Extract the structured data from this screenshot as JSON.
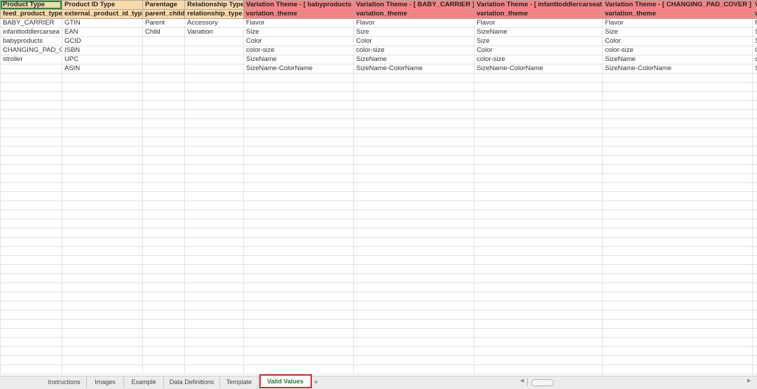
{
  "header_row1": [
    "Product Type",
    "Product ID Type",
    "Parentage",
    "Relationship Type",
    "Variation Theme - [ babyproducts ]",
    "Variation Theme - [ BABY_CARRIER ]",
    "Variation Theme - [ infanttoddlercarseat ]",
    "Variation Theme - [ CHANGING_PAD_COVER ]",
    "V"
  ],
  "header_row2": [
    "feed_product_type",
    "external_product_id_type",
    "parent_child",
    "relationship_type",
    "variation_theme",
    "variation_theme",
    "variation_theme",
    "variation_theme",
    "v"
  ],
  "rows": [
    [
      "BABY_CARRIER",
      "GTIN",
      "Parent",
      "Accessory",
      "Flavor",
      "Flavor",
      "Flavor",
      "Flavor",
      "F"
    ],
    [
      "infanttoddlercarsea",
      "EAN",
      "Child",
      "Variation",
      "Size",
      "Size",
      "SizeName",
      "Size",
      "S"
    ],
    [
      "babyproducts",
      "GCID",
      "",
      "",
      "Color",
      "Color",
      "Size",
      "Color",
      "S"
    ],
    [
      "CHANGING_PAD_C",
      "ISBN",
      "",
      "",
      "color-size",
      "color-size",
      "Color",
      "color-size",
      "C"
    ],
    [
      "stroller",
      "UPC",
      "",
      "",
      "SizeName",
      "SizeName",
      "color-size",
      "SizeName",
      "c"
    ],
    [
      "",
      "ASIN",
      "",
      "",
      "SizeName-ColorName",
      "SizeName-ColorName",
      "SizeName-ColorName",
      "SizeName-ColorName",
      "S"
    ]
  ],
  "sheet_tabs": [
    "Instructions",
    "Images",
    "Example",
    "Data Definitions",
    "Template",
    "Valid Values"
  ],
  "active_tab": "Valid Values",
  "add_sheet_label": "+",
  "colors": {
    "header_orange": "#fcd9a8",
    "header_red": "#f88383",
    "active_tab_text": "#1e7e34",
    "highlight_outline": "#d92b2b"
  }
}
